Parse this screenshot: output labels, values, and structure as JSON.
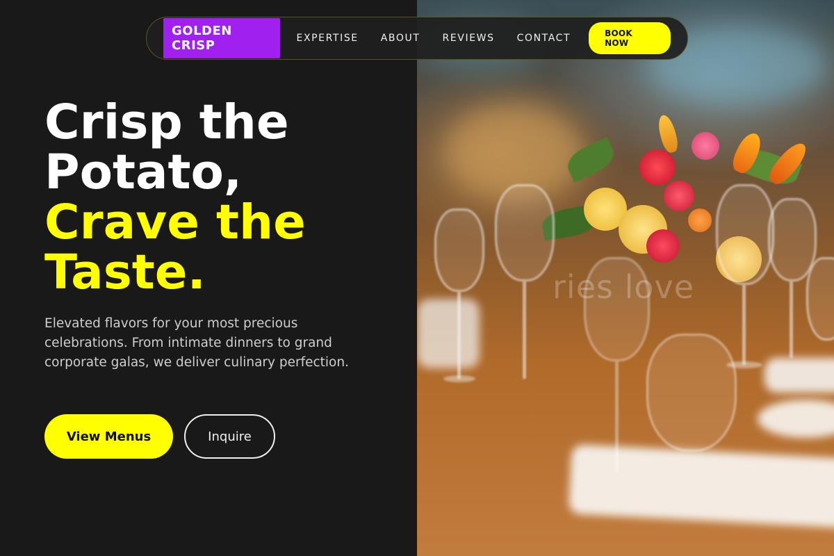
{
  "brand": {
    "name": "GOLDEN CRISP"
  },
  "nav": {
    "links": [
      "EXPERTISE",
      "ABOUT",
      "REVIEWS",
      "CONTACT"
    ],
    "cta": "BOOK NOW"
  },
  "hero": {
    "title_line1": "Crisp the",
    "title_line2": "Potato,",
    "title_line3": "Crave the",
    "title_line4": "Taste.",
    "description": "Elevated flavors for your most precious celebrations. From intimate dinners to grand corporate galas, we deliver culinary perfection.",
    "primary_button": "View Menus",
    "secondary_button": "Inquire"
  },
  "image": {
    "watermark_text": "ries love"
  },
  "colors": {
    "accent_yellow": "#ffff00",
    "brand_purple": "#a020f0",
    "background_dark": "#191919"
  }
}
